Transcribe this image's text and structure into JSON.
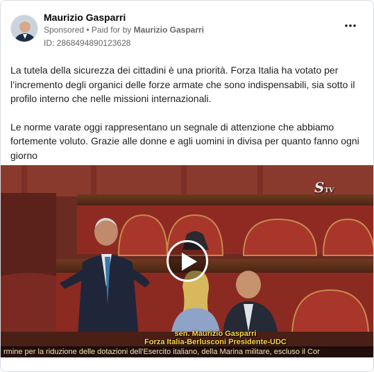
{
  "ad": {
    "advertiser": "Maurizio Gasparri",
    "sponsored": "Sponsored",
    "paid_for_prefix": "• Paid for by",
    "paid_for_name": "Maurizio Gasparri",
    "ad_id": "ID: 2868494890123628",
    "more_icon": "more-horizontal-icon"
  },
  "body": {
    "paragraph1": "La tutela della sicurezza dei cittadini è una priorità. Forza Italia ha votato per l’incremento degli organici delle forze armate che sono indispensabili, sia sotto il profilo interno che nelle missioni internazionali.",
    "paragraph2": "Le norme varate oggi rappresentano un segnale di attenzione che abbiamo fortemente voluto. Grazie alle donne e agli uomini in divisa per quanto fanno ogni giorno"
  },
  "video": {
    "caption_name": "sen. Maurizio Gasparri",
    "caption_party": "Forza Italia-Berlusconi Presidente-UDC",
    "ticker": "rmine per la riduzione delle dotazioni dell'Esercito italiano, della Marina militare, escluso il Cor",
    "channel_logo": "S",
    "channel_logo_suffix": "TV",
    "play_icon": "play-icon"
  }
}
